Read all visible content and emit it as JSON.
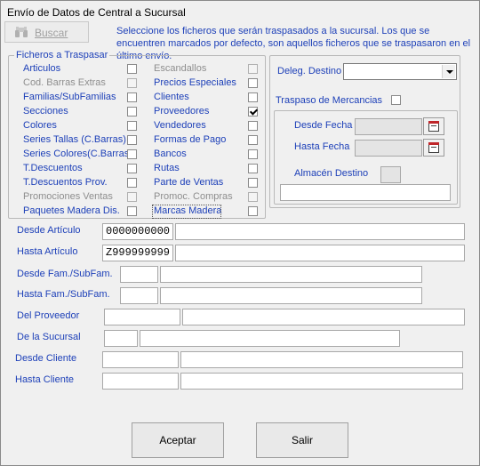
{
  "window": {
    "title": "Envío de Datos de Central a Sucursal"
  },
  "toolbar": {
    "search_label": "Buscar",
    "search_icon": "binoculars-icon"
  },
  "info_text": "Seleccione los ficheros que serán traspasados a la sucursal. Los que se encuentren marcados por defecto, son aquellos ficheros que se traspasaron en el último envío.",
  "files_group": {
    "legend": "Ficheros a Traspasar",
    "left_column": [
      {
        "label": "Articulos",
        "enabled": true,
        "checked": false
      },
      {
        "label": "Cod. Barras Extras",
        "enabled": false,
        "checked": false
      },
      {
        "label": "Familias/SubFamilias",
        "enabled": true,
        "checked": false
      },
      {
        "label": "Secciones",
        "enabled": true,
        "checked": false
      },
      {
        "label": "Colores",
        "enabled": true,
        "checked": false
      },
      {
        "label": "Series Tallas (C.Barras)",
        "enabled": true,
        "checked": false
      },
      {
        "label": "Series Colores(C.Barras)",
        "enabled": true,
        "checked": false
      },
      {
        "label": "T.Descuentos",
        "enabled": true,
        "checked": false
      },
      {
        "label": "T.Descuentos Prov.",
        "enabled": true,
        "checked": false
      },
      {
        "label": "Promociones Ventas",
        "enabled": false,
        "checked": false
      },
      {
        "label": "Paquetes Madera Dis.",
        "enabled": true,
        "checked": false
      }
    ],
    "right_column": [
      {
        "label": "Escandallos",
        "enabled": false,
        "checked": false
      },
      {
        "label": "Precios Especiales",
        "enabled": true,
        "checked": false
      },
      {
        "label": "Clientes",
        "enabled": true,
        "checked": false
      },
      {
        "label": "Proveedores",
        "enabled": true,
        "checked": true
      },
      {
        "label": "Vendedores",
        "enabled": true,
        "checked": false
      },
      {
        "label": "Formas de Pago",
        "enabled": true,
        "checked": false
      },
      {
        "label": "Bancos",
        "enabled": true,
        "checked": false
      },
      {
        "label": "Rutas",
        "enabled": true,
        "checked": false
      },
      {
        "label": "Parte de Ventas",
        "enabled": true,
        "checked": false
      },
      {
        "label": "Promoc. Compras",
        "enabled": false,
        "checked": false
      },
      {
        "label": "Marcas Madera",
        "enabled": true,
        "checked": false
      }
    ]
  },
  "right_panel": {
    "deleg_label": "Deleg. Destino",
    "deleg_value": "",
    "traspaso_label": "Traspaso de Mercancias",
    "traspaso_checked": false,
    "desde_fecha_label": "Desde Fecha",
    "desde_fecha_value": "",
    "hasta_fecha_label": "Hasta Fecha",
    "hasta_fecha_value": "",
    "almacen_label": "Almacén Destino",
    "almacen_code": "",
    "almacen_name": ""
  },
  "filters": {
    "desde_articulo": {
      "label": "Desde Artículo",
      "code": "0000000000",
      "desc": ""
    },
    "hasta_articulo": {
      "label": "Hasta Artículo",
      "code": "Z999999999",
      "desc": ""
    },
    "desde_fam": {
      "label": "Desde Fam./SubFam.",
      "code1": "",
      "code2": ""
    },
    "hasta_fam": {
      "label": "Hasta Fam./SubFam.",
      "code1": "",
      "code2": ""
    },
    "proveedor": {
      "label": "Del Proveedor",
      "code": "",
      "desc": ""
    },
    "sucursal": {
      "label": "De la Sucursal",
      "code": "",
      "desc": ""
    },
    "desde_cliente": {
      "label": "Desde Cliente",
      "code": "",
      "desc": ""
    },
    "hasta_cliente": {
      "label": "Hasta Cliente",
      "code": "",
      "desc": ""
    }
  },
  "buttons": {
    "accept_label": "Aceptar",
    "exit_label": "Salir"
  },
  "colors": {
    "label_blue": "#1c3fb8",
    "disabled_grey": "#8e8e8e",
    "background": "#f0f0f0"
  }
}
